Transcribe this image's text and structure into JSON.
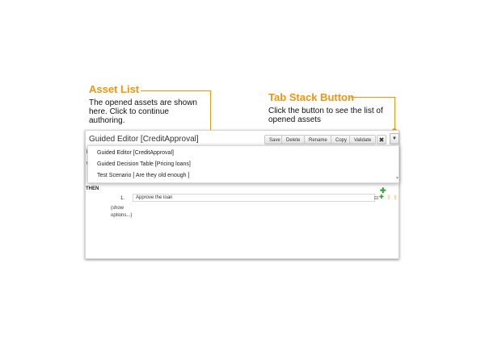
{
  "callouts": {
    "asset_list": {
      "title": "Asset List",
      "body": "The opened assets are shown here. Click to continue authoring."
    },
    "tab_stack": {
      "title": "Tab Stack Button",
      "body": "Click the button to see the list of opened assets"
    }
  },
  "editor": {
    "title": "Guided Editor [CreditApproval]",
    "toolbar": {
      "save": "Save",
      "delete": "Delete",
      "rename": "Rename",
      "copy": "Copy",
      "validate": "Validate",
      "close_icon": "close-icon",
      "stack_icon": "chevron-down-icon"
    },
    "then_label": "THEN",
    "action_row": {
      "number": "1.",
      "text": "Approve the loan"
    },
    "show_options": "(show options...)"
  },
  "asset_list": [
    "Guided Editor [CreditApproval]",
    "Guided Decision Table [Pricing loans]",
    "Test Scenario [ Are they old enough ]"
  ],
  "colors": {
    "accent": "#f0950f"
  }
}
